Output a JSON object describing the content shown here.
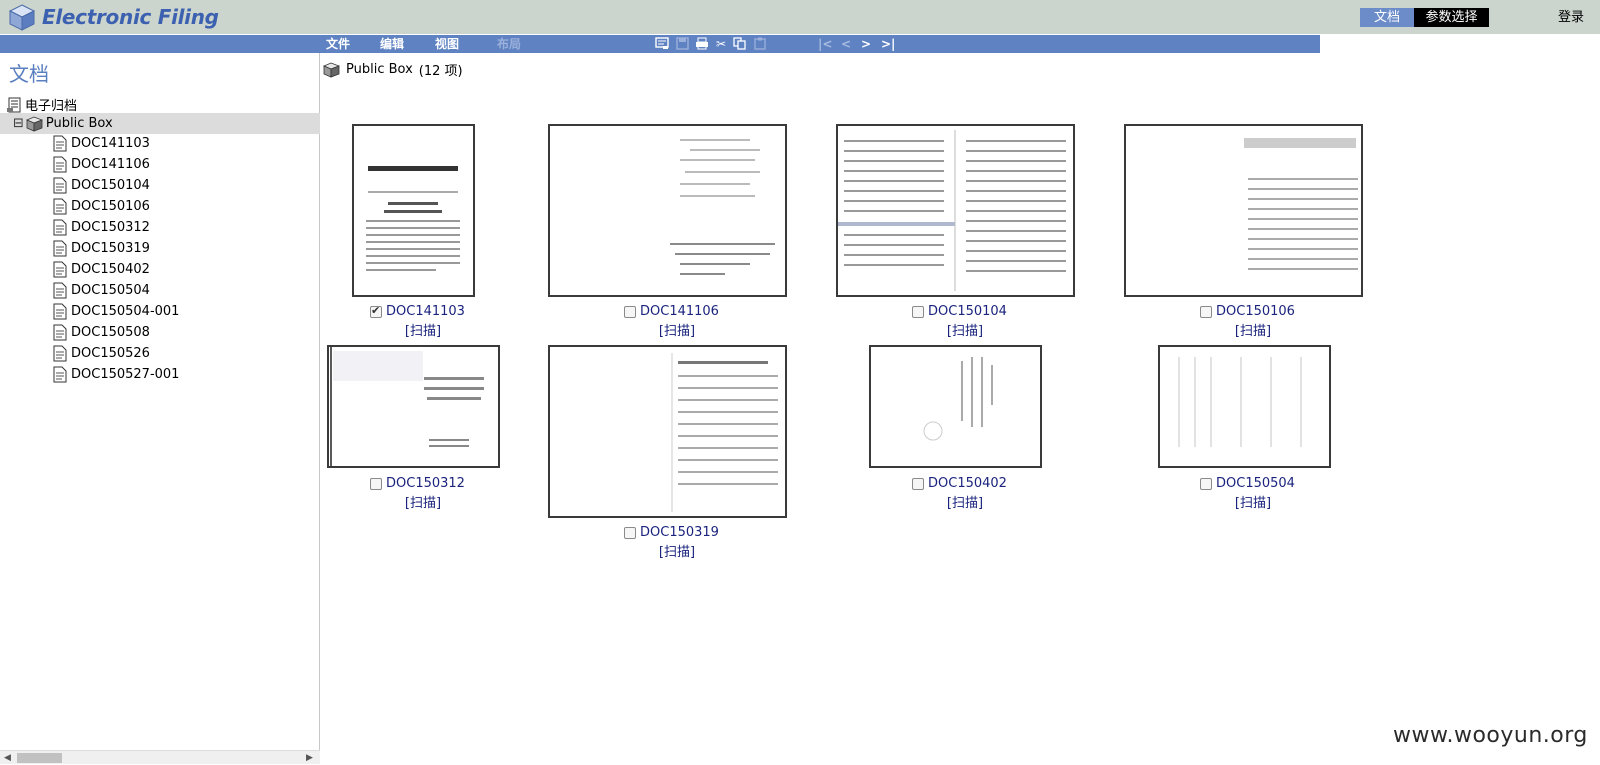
{
  "header": {
    "app_title": "Electronic Filing",
    "tab_docs": "文档",
    "tab_params": "参数选择",
    "login": "登录"
  },
  "menu": {
    "file": "文件",
    "edit": "编辑",
    "view": "视图",
    "layout": "布局",
    "nav_first": "|<",
    "nav_prev": "<",
    "nav_next": ">",
    "nav_last": ">|"
  },
  "sidebar": {
    "title": "文档",
    "root_label": "电子归档",
    "box_label": "Public Box",
    "expander": "⊟",
    "docs": [
      "DOC141103",
      "DOC141106",
      "DOC150104",
      "DOC150106",
      "DOC150312",
      "DOC150319",
      "DOC150402",
      "DOC150504",
      "DOC150504-001",
      "DOC150508",
      "DOC150526",
      "DOC150527-001"
    ]
  },
  "main": {
    "box_name": "Public Box",
    "item_count": "(12 项)",
    "scan_label": "[扫描]",
    "thumbnails": [
      {
        "name": "DOC141103",
        "checked": true
      },
      {
        "name": "DOC141106",
        "checked": false
      },
      {
        "name": "DOC150104",
        "checked": false
      },
      {
        "name": "DOC150106",
        "checked": false
      },
      {
        "name": "DOC150312",
        "checked": false
      },
      {
        "name": "DOC150319",
        "checked": false
      },
      {
        "name": "DOC150402",
        "checked": false
      },
      {
        "name": "DOC150504",
        "checked": false
      }
    ]
  },
  "watermark": "www.wooyun.org",
  "colors": {
    "header_bg": "#ccd5cd",
    "menubar_bg": "#5f82c3",
    "brand": "#3c61b0",
    "link": "#1a237e"
  }
}
